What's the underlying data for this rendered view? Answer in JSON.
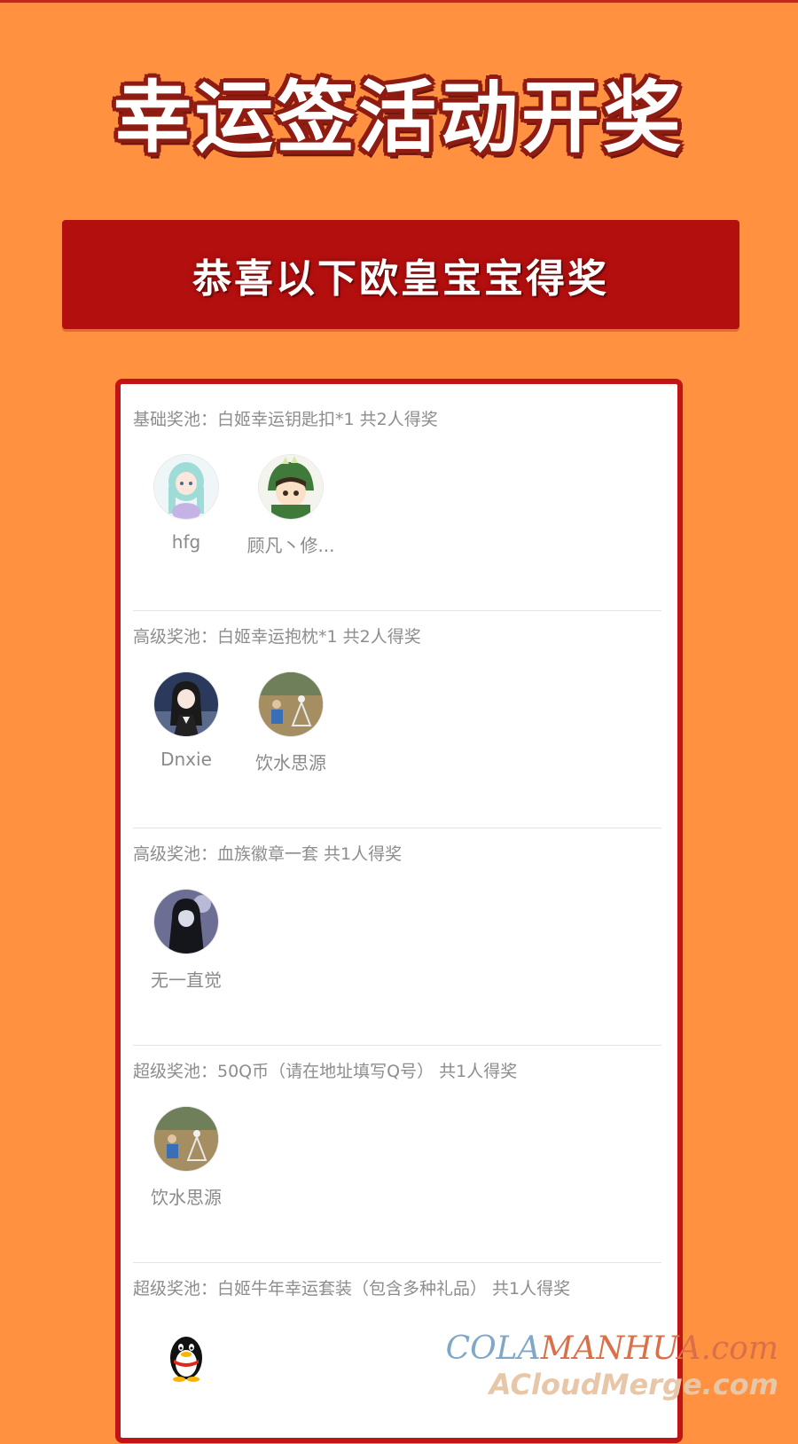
{
  "headline": "幸运签活动开奖",
  "banner": "恭喜以下欧皇宝宝得奖",
  "sections": [
    {
      "title": "基础奖池：白姬幸运钥匙扣*1 共2人得奖",
      "winners": [
        {
          "name": "hfg",
          "avatar_icon": "anime-girl-avatar-icon"
        },
        {
          "name": "顾凡丶修...",
          "avatar_icon": "dinosaur-hood-avatar-icon"
        }
      ]
    },
    {
      "title": "高级奖池：白姬幸运抱枕*1 共2人得奖",
      "winners": [
        {
          "name": "Dnxie",
          "avatar_icon": "anime-character-avatar-icon"
        },
        {
          "name": "饮水思源",
          "avatar_icon": "photo-avatar-icon"
        }
      ]
    },
    {
      "title": "高级奖池：血族徽章一套 共1人得奖",
      "winners": [
        {
          "name": "无一直觉",
          "avatar_icon": "dark-figure-avatar-icon"
        }
      ]
    },
    {
      "title": "超级奖池：50Q币（请在地址填写Q号） 共1人得奖",
      "winners": [
        {
          "name": "饮水思源",
          "avatar_icon": "photo-avatar-icon"
        }
      ]
    },
    {
      "title": "超级奖池：白姬牛年幸运套装（包含多种礼品） 共1人得奖",
      "winners": [
        {
          "name": "",
          "avatar_icon": "qq-penguin-icon"
        }
      ]
    }
  ],
  "watermark": {
    "line1_a": "COLA",
    "line1_b": "MANHUA.com",
    "line2": "ACloudMerge.com"
  }
}
